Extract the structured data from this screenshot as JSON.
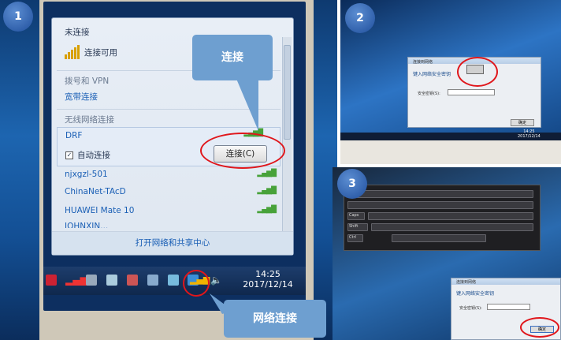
{
  "steps": {
    "s1": "1",
    "s2": "2",
    "s3": "3"
  },
  "popup": {
    "status": "未连接",
    "available": "连接可用",
    "dialup_header": "拨号和 VPN",
    "broadband": "宽带连接",
    "wireless_header": "无线网络连接",
    "networks": [
      {
        "name": "DRF"
      },
      {
        "name": "njxgzl-501"
      },
      {
        "name": "ChinaNet-TAcD"
      },
      {
        "name": "HUAWEI Mate 10"
      },
      {
        "name": "JOHNXIN..."
      }
    ],
    "auto_connect": "自动连接",
    "connect_button": "连接(C)",
    "open_center": "打开网络和共享中心"
  },
  "taskbar": {
    "time": "14:25",
    "date": "2017/12/14"
  },
  "callouts": {
    "connect": "连接",
    "network": "网络连接"
  },
  "panel2": {
    "dialog_title": "连接到网络",
    "prompt": "键入网络安全密钥",
    "field_label": "安全密钥(S):",
    "ok": "确定",
    "time": "14:25",
    "date": "2017/12/14"
  },
  "panel3": {
    "dialog_title": "连接到网络",
    "prompt": "键入网络安全密钥",
    "field_label": "安全密钥(S):",
    "ok": "确定",
    "keys_caps": "Caps",
    "keys_shift": "Shift",
    "keys_ctrl": "Ctrl"
  },
  "colors": {
    "accent_red": "#e0161b",
    "callout_blue": "#6e9fd0",
    "wifi_green": "#47a23a"
  },
  "icons": {
    "wifi": "wifi-signal-icon",
    "checkbox": "checkbox-icon"
  }
}
